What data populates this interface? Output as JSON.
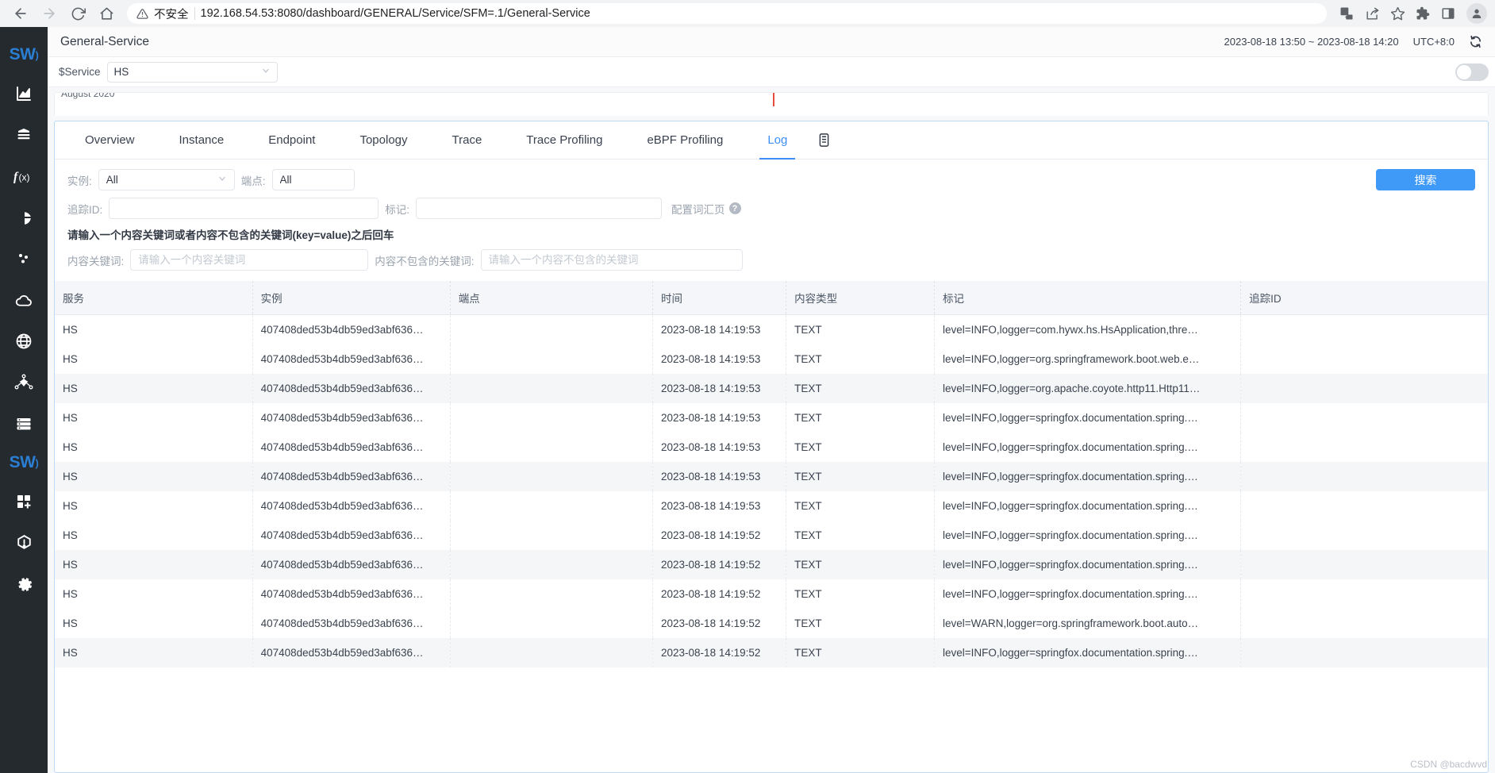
{
  "browser": {
    "back_icon": "back-arrow-icon",
    "forward_icon": "forward-arrow-icon",
    "reload_icon": "reload-icon",
    "home_icon": "home-icon",
    "security_label": "不安全",
    "url": "192.168.54.53:8080/dashboard/GENERAL/Service/SFM=.1/General-Service",
    "icons": [
      "translate-icon",
      "share-icon",
      "bookmark-star-icon",
      "extensions-icon",
      "side-panel-icon",
      "profile-avatar-icon"
    ]
  },
  "sidebar": {
    "logo": "SW",
    "items": [
      {
        "name": "dashboard-chart-icon"
      },
      {
        "name": "database-icon"
      },
      {
        "name": "function-icon",
        "label": "f(x)"
      },
      {
        "name": "pie-chart-icon"
      },
      {
        "name": "scatter-dots-icon"
      },
      {
        "name": "cloud-icon"
      },
      {
        "name": "globe-icon"
      },
      {
        "name": "topology-node-icon"
      },
      {
        "name": "server-list-icon"
      },
      {
        "name": "skywalking-logo-icon",
        "label": "SW"
      },
      {
        "name": "add-widget-icon"
      },
      {
        "name": "alarm-icon"
      },
      {
        "name": "settings-gear-icon"
      }
    ]
  },
  "header": {
    "title": "General-Service",
    "time_range": "2023-08-18 13:50 ~ 2023-08-18 14:20",
    "timezone": "UTC+8:0",
    "refresh_icon": "refresh-icon"
  },
  "service_bar": {
    "label": "$Service",
    "value": "HS",
    "toggle_state": "off"
  },
  "chart_strip": {
    "label": "August 2020"
  },
  "tabs": [
    {
      "label": "Overview",
      "active": false
    },
    {
      "label": "Instance",
      "active": false
    },
    {
      "label": "Endpoint",
      "active": false
    },
    {
      "label": "Topology",
      "active": false
    },
    {
      "label": "Trace",
      "active": false
    },
    {
      "label": "Trace Profiling",
      "active": false
    },
    {
      "label": "eBPF Profiling",
      "active": false
    },
    {
      "label": "Log",
      "active": true
    }
  ],
  "filters": {
    "instance_label": "实例:",
    "instance_value": "All",
    "endpoint_label": "端点:",
    "endpoint_value": "All",
    "trace_id_label": "追踪ID:",
    "trace_id_value": "",
    "tag_label": "标记:",
    "tag_value": "",
    "vocab_link": "配置词汇页",
    "hint": "请输入一个内容关键词或者内容不包含的关键词(key=value)之后回车",
    "keyword_label": "内容关键词:",
    "keyword_placeholder": "请输入一个内容关键词",
    "exclude_label": "内容不包含的关键词:",
    "exclude_placeholder": "请输入一个内容不包含的关键词",
    "search_button": "搜索"
  },
  "table": {
    "columns": [
      "服务",
      "实例",
      "端点",
      "时间",
      "内容类型",
      "标记",
      "追踪ID"
    ],
    "rows": [
      {
        "service": "HS",
        "instance": "407408ded53b4db59ed3abf636…",
        "endpoint": "",
        "time": "2023-08-18 14:19:53",
        "type": "TEXT",
        "tags": "level=INFO,logger=com.hywx.hs.HsApplication,thre…",
        "trace_id": ""
      },
      {
        "service": "HS",
        "instance": "407408ded53b4db59ed3abf636…",
        "endpoint": "",
        "time": "2023-08-18 14:19:53",
        "type": "TEXT",
        "tags": "level=INFO,logger=org.springframework.boot.web.e…",
        "trace_id": ""
      },
      {
        "service": "HS",
        "instance": "407408ded53b4db59ed3abf636…",
        "endpoint": "",
        "time": "2023-08-18 14:19:53",
        "type": "TEXT",
        "tags": "level=INFO,logger=org.apache.coyote.http11.Http11…",
        "trace_id": ""
      },
      {
        "service": "HS",
        "instance": "407408ded53b4db59ed3abf636…",
        "endpoint": "",
        "time": "2023-08-18 14:19:53",
        "type": "TEXT",
        "tags": "level=INFO,logger=springfox.documentation.spring.…",
        "trace_id": ""
      },
      {
        "service": "HS",
        "instance": "407408ded53b4db59ed3abf636…",
        "endpoint": "",
        "time": "2023-08-18 14:19:53",
        "type": "TEXT",
        "tags": "level=INFO,logger=springfox.documentation.spring.…",
        "trace_id": ""
      },
      {
        "service": "HS",
        "instance": "407408ded53b4db59ed3abf636…",
        "endpoint": "",
        "time": "2023-08-18 14:19:53",
        "type": "TEXT",
        "tags": "level=INFO,logger=springfox.documentation.spring.…",
        "trace_id": ""
      },
      {
        "service": "HS",
        "instance": "407408ded53b4db59ed3abf636…",
        "endpoint": "",
        "time": "2023-08-18 14:19:53",
        "type": "TEXT",
        "tags": "level=INFO,logger=springfox.documentation.spring.…",
        "trace_id": ""
      },
      {
        "service": "HS",
        "instance": "407408ded53b4db59ed3abf636…",
        "endpoint": "",
        "time": "2023-08-18 14:19:52",
        "type": "TEXT",
        "tags": "level=INFO,logger=springfox.documentation.spring.…",
        "trace_id": ""
      },
      {
        "service": "HS",
        "instance": "407408ded53b4db59ed3abf636…",
        "endpoint": "",
        "time": "2023-08-18 14:19:52",
        "type": "TEXT",
        "tags": "level=INFO,logger=springfox.documentation.spring.…",
        "trace_id": ""
      },
      {
        "service": "HS",
        "instance": "407408ded53b4db59ed3abf636…",
        "endpoint": "",
        "time": "2023-08-18 14:19:52",
        "type": "TEXT",
        "tags": "level=INFO,logger=springfox.documentation.spring.…",
        "trace_id": ""
      },
      {
        "service": "HS",
        "instance": "407408ded53b4db59ed3abf636…",
        "endpoint": "",
        "time": "2023-08-18 14:19:52",
        "type": "TEXT",
        "tags": "level=WARN,logger=org.springframework.boot.auto…",
        "trace_id": ""
      },
      {
        "service": "HS",
        "instance": "407408ded53b4db59ed3abf636…",
        "endpoint": "",
        "time": "2023-08-18 14:19:52",
        "type": "TEXT",
        "tags": "level=INFO,logger=springfox.documentation.spring.…",
        "trace_id": ""
      }
    ]
  },
  "watermark": "CSDN @bacdwvd"
}
